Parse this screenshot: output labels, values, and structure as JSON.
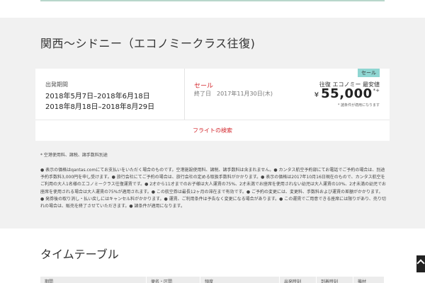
{
  "page": {
    "route_title": "関西〜シドニー（エコノミークラス往復)",
    "card": {
      "period_label": "出発期間",
      "periods": [
        "2018年5月7日–2018年6月18日",
        "2018年8月18日–2018年8月29日"
      ],
      "sale_label": "セール",
      "sale_end": "終了日　2017年11月30日(木)",
      "badge": "セール",
      "fare_type": "往復 エコノミー 最安値",
      "currency_symbol": "¥",
      "price": "55,000",
      "price_marks": "*+",
      "condition_note": "* 諸条件が適用になります",
      "search_link": "フライトの検索"
    },
    "fee_note": "* 空港使用料、諸税、諸手数料別途",
    "disclaimer": "● 表示の価格はqantas.comにてお支払いをいただく場合のものです。空港施設使用料、諸税、諸手数料は含まれません。● カンタス航空予約部にてお電話でご予約の場合は、別途予約手数料3,000円を申し受けます。● 旅行会社にてご予約の場合は、旅行会社の定める取扱手数料がかかります。● 表示の価格は2017年10月16日現在のもので、カンタス航空をご利用の大人1名様のエコノミークラス往復運賃です。● 2才から11才までのお子様は大人運賃の75%、2才未満でお座席を使用されない幼児は大人運賃の10%、2才未満の幼児でお座席を使用される場合は大人運賃の75%が適用されます。● この航空券は最長12ヶ月の滞在まで有効です。● ご予約の変更には、変更料、手数料および運賃の差額がかかります。● 発券後の取り消し・払い戻しにはキャンセル料がかかります。● 運賃、ご利用条件は予告なく変更になる場合があります。● この運賃でご用意できる座席には限りがあり、売り切れの場合は、販売を終了させていただきます。● 諸条件が適用になります。",
    "timetable_title": "タイムテーブル",
    "timetable_headers": [
      "期間",
      "便名・区間",
      "頻度",
      "出発時刻",
      "到着時刻",
      "機材"
    ]
  },
  "colors": {
    "accent_red": "#d3272d",
    "badge_teal": "#8fd6d2",
    "panel_grey": "#f1f1f1"
  },
  "icons": {
    "scroll_top": "chevron-up-icon"
  }
}
